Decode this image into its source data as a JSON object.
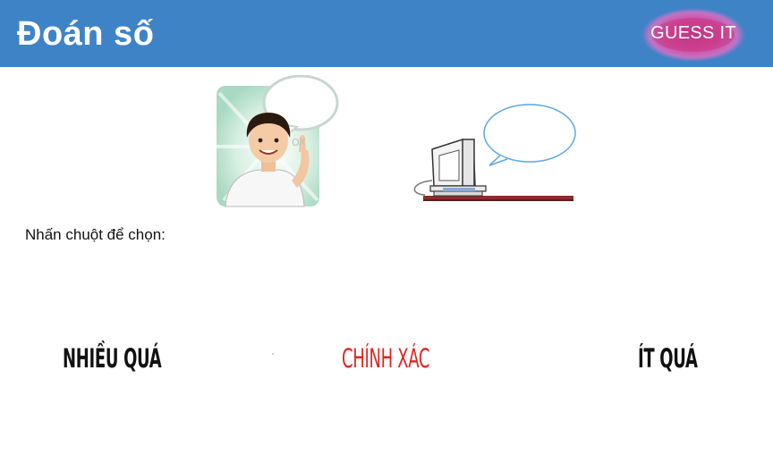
{
  "header": {
    "title": "Đoán số",
    "logo_text": "GUESS IT"
  },
  "instruction": "Nhấn chuột để chọn:",
  "choices": [
    {
      "label": "NHIỀU QUÁ",
      "color": "#111111"
    },
    {
      "label": "CHÍNH XÁC",
      "color": "#e0231f"
    },
    {
      "label": "ÍT QUÁ",
      "color": "#111111"
    }
  ],
  "colors": {
    "header_bg": "#3f83c7",
    "logo_glow": "#e35bb7"
  },
  "illustrations": {
    "person": "person-pointing-with-speech-bubble",
    "computer": "computer-with-speech-bubble"
  }
}
